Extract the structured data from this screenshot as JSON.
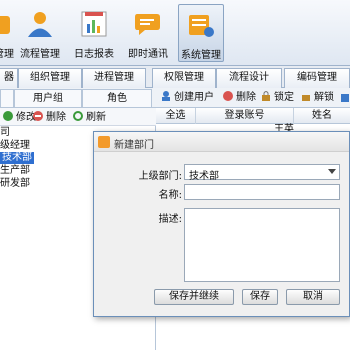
{
  "toolbar": {
    "items": [
      {
        "label": "管理"
      },
      {
        "label": "流程管理"
      },
      {
        "label": "日志报表"
      },
      {
        "label": "即时通讯"
      },
      {
        "label": "系统管理"
      }
    ]
  },
  "tabs": [
    {
      "label": "器"
    },
    {
      "label": "组织管理"
    },
    {
      "label": "进程管理"
    },
    {
      "label": "权限管理"
    },
    {
      "label": "流程设计"
    },
    {
      "label": "编码管理"
    }
  ],
  "subtabs": [
    {
      "label": "用户组"
    },
    {
      "label": "角色"
    }
  ],
  "left_toolbar": {
    "edit": "修改",
    "delete": "删除",
    "refresh": "刷新"
  },
  "tree": [
    {
      "label": "司"
    },
    {
      "label": "级经理"
    },
    {
      "label": "技术部"
    },
    {
      "label": "生产部"
    },
    {
      "label": "研发部"
    }
  ],
  "right_toolbar": {
    "create_user": "创建用户",
    "delete": "删除",
    "lock": "锁定",
    "unlock": "解锁"
  },
  "grid": {
    "columns": [
      "全选",
      "登录账号",
      "姓名"
    ],
    "first_row_name": "王英"
  },
  "dialog": {
    "title": "新建部门",
    "parent_label": "上级部门:",
    "parent_value": "技术部",
    "name_label": "名称:",
    "name_value": "",
    "desc_label": "描述:",
    "desc_value": "",
    "save_continue": "保存并继续",
    "save": "保存",
    "cancel": "取消"
  },
  "colors": {
    "accent": "#2f6fd0",
    "border": "#9fb3cc"
  }
}
